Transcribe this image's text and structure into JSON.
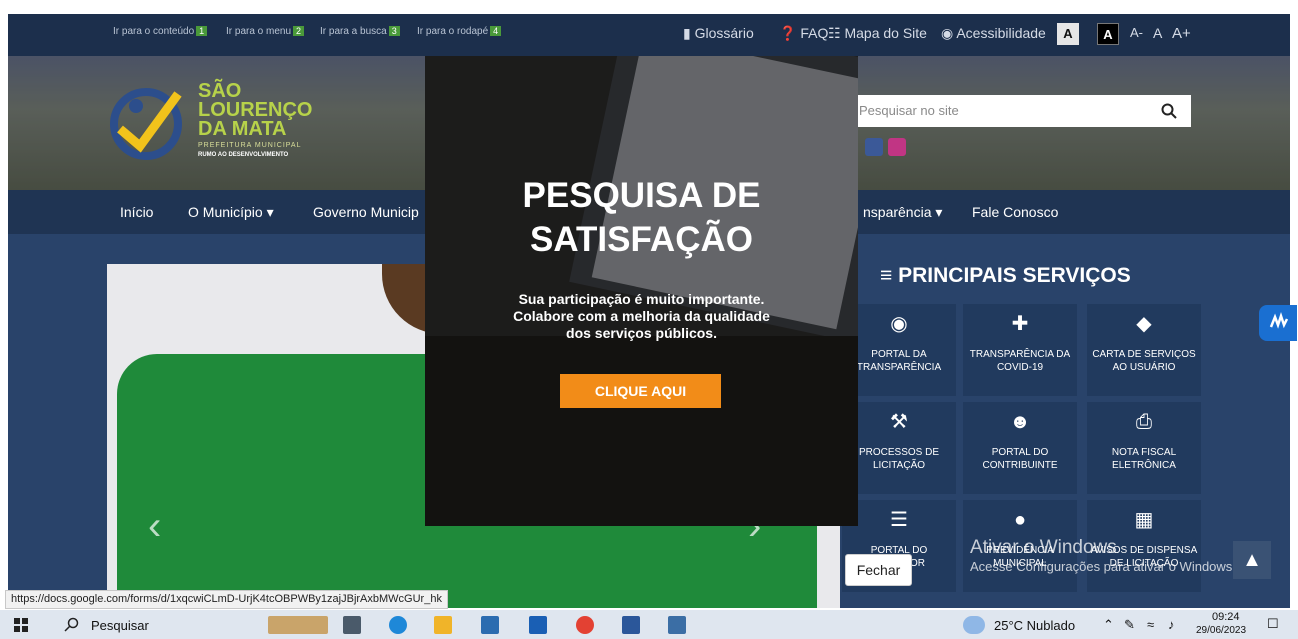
{
  "topbar": {
    "skip_links": [
      {
        "label": "Ir para o conteúdo",
        "num": "1"
      },
      {
        "label": "Ir para o menu",
        "num": "2"
      },
      {
        "label": "Ir para a busca",
        "num": "3"
      },
      {
        "label": "Ir para o rodapé",
        "num": "4"
      }
    ],
    "glossario": "Glossário",
    "faq": "FAQ",
    "mapa": "Mapa do Site",
    "acessibilidade": "Acessibilidade",
    "contrast_a1": "A",
    "contrast_a2": "A",
    "font_minus": "A-",
    "font_normal": "A",
    "font_plus": "A+"
  },
  "header": {
    "logo_line1": "SÃO",
    "logo_line2": "LOURENÇO",
    "logo_line3": "DA MATA",
    "logo_sub": "PREFEITURA MUNICIPAL",
    "logo_slogan": "RUMO AO DESENVOLVIMENTO",
    "search_placeholder": "Pesquisar no site"
  },
  "nav": {
    "items": [
      "Início",
      "O Município",
      "Governo Municip",
      "nsparência",
      "Fale Conosco"
    ]
  },
  "services": {
    "title": "PRINCIPAIS SERVIÇOS",
    "tiles": [
      {
        "label": "PORTAL DA TRANSPARÊNCIA",
        "icon": "money-bag-icon"
      },
      {
        "label": "TRANSPARÊNCIA DA COVID-19",
        "icon": "plus-cross-icon"
      },
      {
        "label": "CARTA DE SERVIÇOS AO USUÁRIO",
        "icon": "tag-icon"
      },
      {
        "label": "PROCESSOS DE LICITAÇÃO",
        "icon": "gavel-icon"
      },
      {
        "label": "PORTAL DO CONTRIBUINTE",
        "icon": "users-icon"
      },
      {
        "label": "NOTA FISCAL ELETRÔNICA",
        "icon": "printer-icon"
      },
      {
        "label": "PORTAL DO SERVIDOR",
        "icon": "file-search-icon"
      },
      {
        "label": "PREVIDÊNCIA MUNICIPAL",
        "icon": "user-search-icon"
      },
      {
        "label": "AVISOS DE DISPENSA DE LICITAÇÃO",
        "icon": "newspaper-icon"
      }
    ]
  },
  "popup": {
    "title_line1": "PESQUISA DE",
    "title_line2": "SATISFAÇÃO",
    "text_line1": "Sua participação é muito importante.",
    "text_line2": "Colabore com a melhoria da qualidade",
    "text_line3": "dos serviços públicos.",
    "cta": "CLIQUE AQUI",
    "close": "Fechar"
  },
  "watermark": {
    "line1": "Ativar o Windows",
    "line2": "Acesse Configurações para ativar o Windows."
  },
  "status_url": "https://docs.google.com/forms/d/1xqcwiCLmD-UrjK4tcOBPWBy1zajJBjrAxbMWcGUr_hk",
  "taskbar": {
    "search": "Pesquisar",
    "weather": "25°C  Nublado",
    "time": "09:24",
    "date": "29/06/2023"
  },
  "colors": {
    "site_bg": "#1f3352",
    "accent_orange": "#f28c18",
    "logo_green": "#b7d24a"
  }
}
